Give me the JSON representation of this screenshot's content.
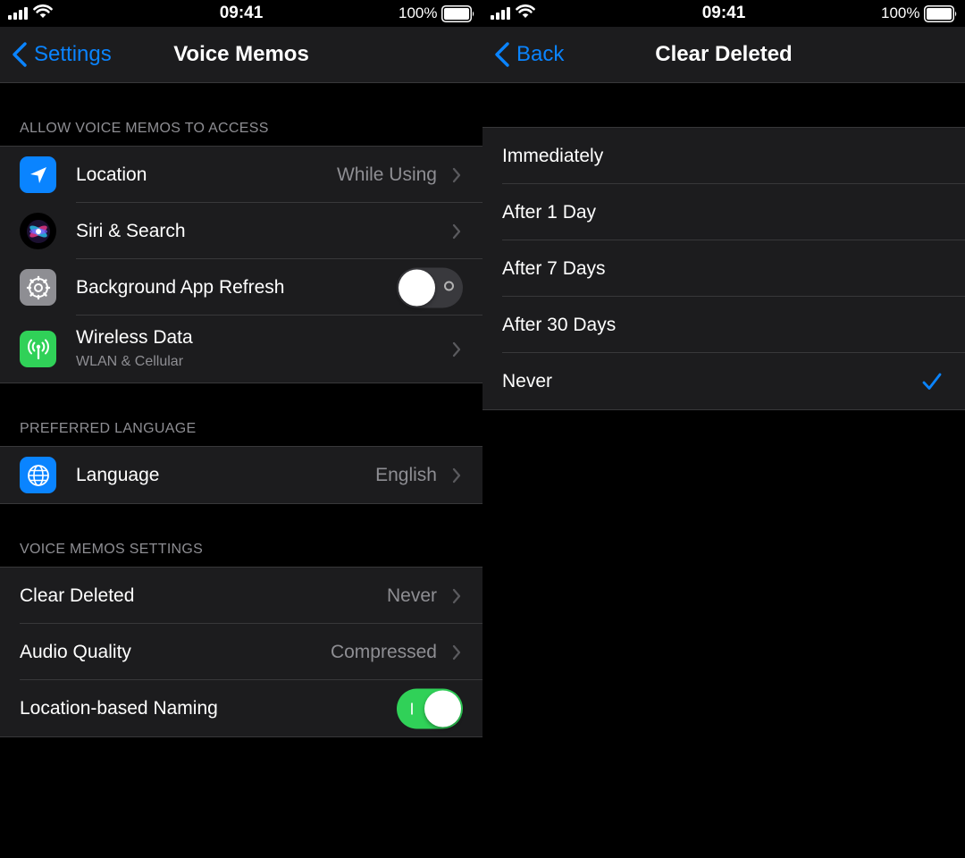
{
  "status_bar": {
    "time": "09:41",
    "battery": "100%"
  },
  "left": {
    "nav": {
      "back_label": "Settings",
      "title": "Voice Memos"
    },
    "section_access": {
      "header": "ALLOW VOICE MEMOS TO ACCESS",
      "location": {
        "label": "Location",
        "value": "While Using",
        "icon": "location-arrow-icon",
        "color": "#0a84ff"
      },
      "siri": {
        "label": "Siri & Search",
        "icon": "siri-icon"
      },
      "background_refresh": {
        "label": "Background App Refresh",
        "on": false,
        "icon": "gear-icon"
      },
      "wireless": {
        "label": "Wireless Data",
        "sublabel": "WLAN & Cellular",
        "icon": "antenna-icon",
        "color": "#30d158"
      }
    },
    "section_language": {
      "header": "PREFERRED LANGUAGE",
      "language": {
        "label": "Language",
        "value": "English",
        "icon": "globe-icon"
      }
    },
    "section_settings": {
      "header": "VOICE MEMOS SETTINGS",
      "clear_deleted": {
        "label": "Clear Deleted",
        "value": "Never"
      },
      "audio_quality": {
        "label": "Audio Quality",
        "value": "Compressed"
      },
      "location_naming": {
        "label": "Location-based Naming",
        "on": true
      }
    }
  },
  "right": {
    "nav": {
      "back_label": "Back",
      "title": "Clear Deleted"
    },
    "options": [
      {
        "label": "Immediately",
        "selected": false
      },
      {
        "label": "After 1 Day",
        "selected": false
      },
      {
        "label": "After 7 Days",
        "selected": false
      },
      {
        "label": "After 30 Days",
        "selected": false
      },
      {
        "label": "Never",
        "selected": true
      }
    ]
  },
  "colors": {
    "accent": "#0a84ff",
    "toggle_on": "#30d158",
    "cell_bg": "#1c1c1e",
    "secondary_text": "#8e8e93"
  }
}
